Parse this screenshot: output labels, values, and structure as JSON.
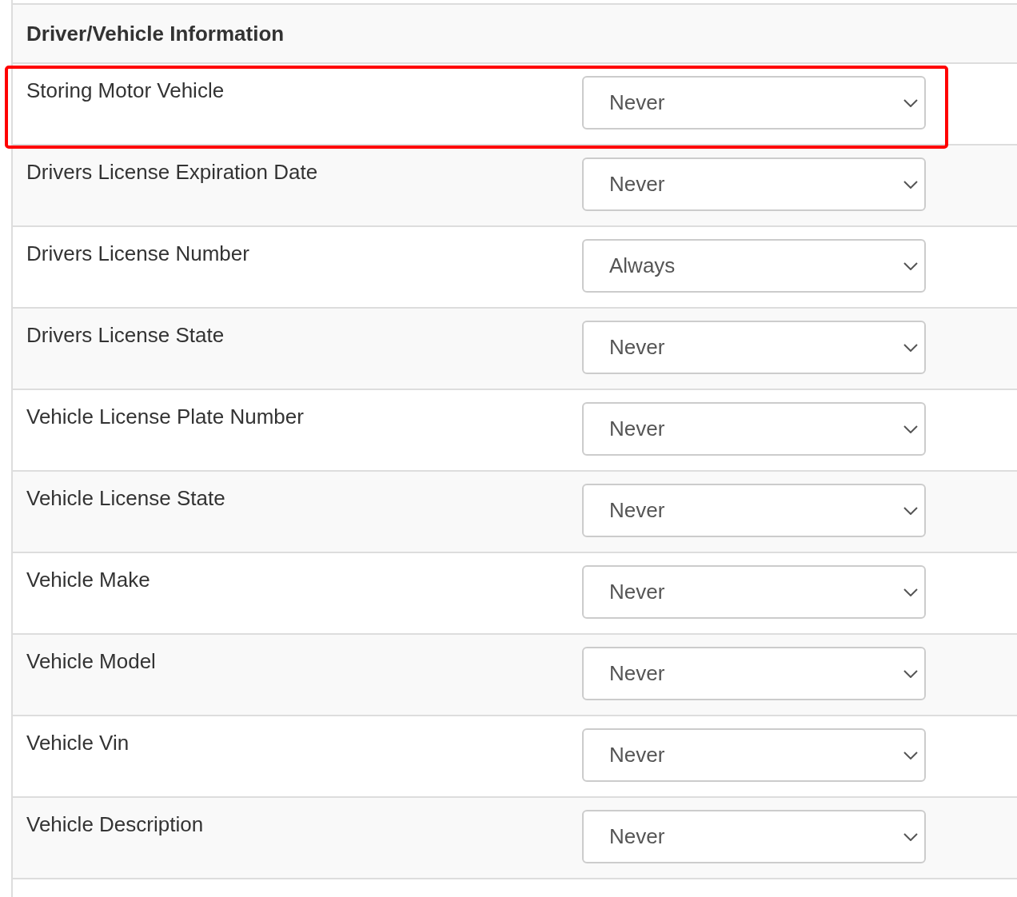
{
  "section": {
    "title": "Driver/Vehicle Information"
  },
  "rows": [
    {
      "label": "Storing Motor Vehicle",
      "value": "Never",
      "highlighted": true
    },
    {
      "label": "Drivers License Expiration Date",
      "value": "Never",
      "highlighted": false
    },
    {
      "label": "Drivers License Number",
      "value": "Always",
      "highlighted": false
    },
    {
      "label": "Drivers License State",
      "value": "Never",
      "highlighted": false
    },
    {
      "label": "Vehicle License Plate Number",
      "value": "Never",
      "highlighted": false
    },
    {
      "label": "Vehicle License State",
      "value": "Never",
      "highlighted": false
    },
    {
      "label": "Vehicle Make",
      "value": "Never",
      "highlighted": false
    },
    {
      "label": "Vehicle Model",
      "value": "Never",
      "highlighted": false
    },
    {
      "label": "Vehicle Vin",
      "value": "Never",
      "highlighted": false
    },
    {
      "label": "Vehicle Description",
      "value": "Never",
      "highlighted": false
    }
  ]
}
